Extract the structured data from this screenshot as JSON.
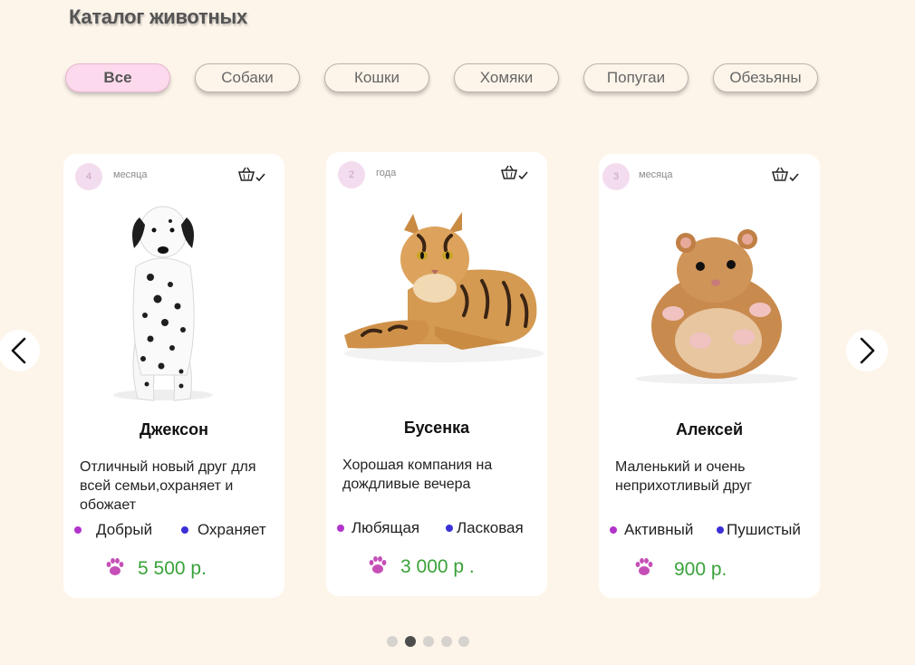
{
  "page": {
    "title": "Каталог животных"
  },
  "filters": [
    "Все",
    "Собаки",
    "Кошки",
    "Хомяки",
    "Попугаи",
    "Обезьяны"
  ],
  "active_filter": "Все",
  "cards": [
    {
      "age_number": "4",
      "age_unit": "месяца",
      "name": "Джексон",
      "description": "Отличный новый друг для всей семьи,охраняет и обожает",
      "traits": [
        {
          "label": "Добрый",
          "color": "#b233cc"
        },
        {
          "label": "Охраняет",
          "color": "#3b2fd6"
        }
      ],
      "price": "5 500 р.",
      "image": "dalmatian-dog-image"
    },
    {
      "age_number": "2",
      "age_unit": "года",
      "name": "Бусенка",
      "description": "Хорошая компания на дождливые вечера",
      "traits": [
        {
          "label": "Любящая",
          "color": "#b233cc"
        },
        {
          "label": "Ласковая",
          "color": "#3b2fd6"
        }
      ],
      "price": "3 000 р .",
      "image": "bengal-cat-image"
    },
    {
      "age_number": "3",
      "age_unit": "месяца",
      "name": "Алексей",
      "description": "Маленький и очень неприхотливый друг",
      "traits": [
        {
          "label": "Активный",
          "color": "#b233cc"
        },
        {
          "label": "Пушистый",
          "color": "#3b2fd6"
        }
      ],
      "price": "900 р.",
      "image": "hamster-image"
    }
  ],
  "carousel": {
    "page_count": 5,
    "active_page": 2
  },
  "colors": {
    "background": "#fdf5ea",
    "active_chip": "#fcd9ec",
    "price": "#3aa23a",
    "paw": "#c54fb7",
    "badge": "#f4dcef"
  },
  "icons": [
    "basket-check-icon",
    "paw-icon",
    "arrow-left-icon",
    "arrow-right-icon"
  ]
}
